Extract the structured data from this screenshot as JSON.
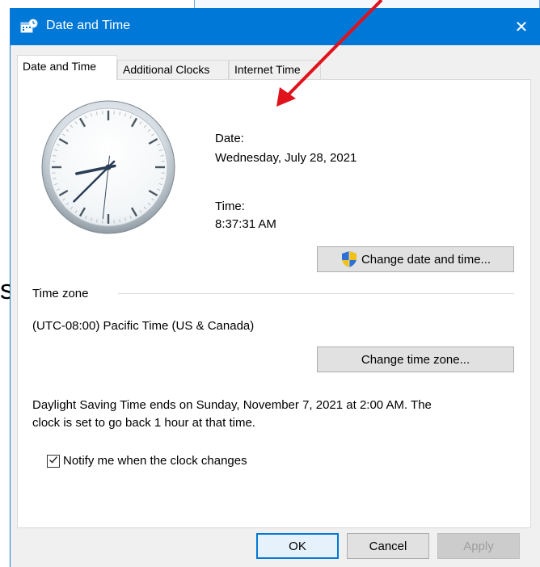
{
  "background": {
    "fragment_text": "s"
  },
  "window": {
    "title": "Date and Time",
    "title_icon": "date-time-settings-icon",
    "close_glyph": "✕",
    "titlebar_color": "#0078d7"
  },
  "tabs": [
    {
      "label": "Date and Time",
      "active": true
    },
    {
      "label": "Additional Clocks",
      "active": false
    },
    {
      "label": "Internet Time",
      "active": false
    }
  ],
  "clock": {
    "icon": "analog-clock-icon",
    "hour": 8,
    "minute": 37,
    "second": 31
  },
  "date_section": {
    "date_label": "Date:",
    "date_value": "Wednesday, July 28, 2021",
    "time_label": "Time:",
    "time_value": "8:37:31 AM",
    "change_button": "Change date and time...",
    "change_button_icon": "uac-shield-icon"
  },
  "time_zone": {
    "heading": "Time zone",
    "value": "(UTC-08:00) Pacific Time (US & Canada)",
    "change_button": "Change time zone..."
  },
  "dst": {
    "line1": "Daylight Saving Time ends on Sunday, November 7, 2021 at 2:00 AM. The",
    "line2": "clock is set to go back 1 hour at that time."
  },
  "notify": {
    "label": "Notify me when the clock changes",
    "checked": true
  },
  "footer": {
    "ok": "OK",
    "cancel": "Cancel",
    "apply": "Apply"
  },
  "annotation": {
    "arrow_color": "#e0121b"
  }
}
